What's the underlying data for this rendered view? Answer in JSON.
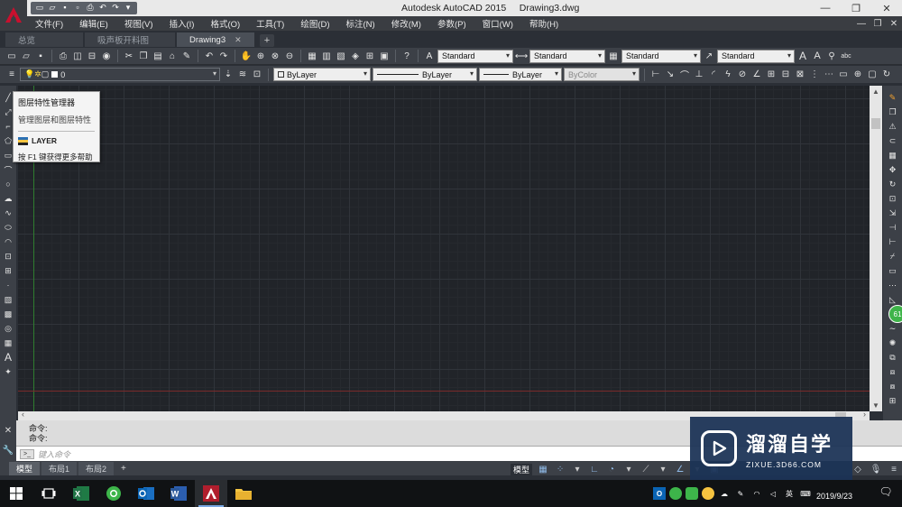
{
  "window": {
    "app_name": "Autodesk AutoCAD 2015",
    "doc_name": "Drawing3.dwg",
    "controls": [
      "—",
      "❐",
      "✕"
    ]
  },
  "menu": {
    "items": [
      "文件(F)",
      "编辑(E)",
      "视图(V)",
      "插入(I)",
      "格式(O)",
      "工具(T)",
      "绘图(D)",
      "标注(N)",
      "修改(M)",
      "参数(P)",
      "窗口(W)",
      "帮助(H)"
    ],
    "right_controls": [
      "—",
      "❐",
      "✕"
    ]
  },
  "file_tabs": [
    {
      "label": "总览"
    },
    {
      "label": "吸声板开料图"
    },
    {
      "label": "Drawing3",
      "close": "✕"
    }
  ],
  "file_tab_add": "+",
  "toolbar1": {
    "text_style": "Standard",
    "dim_style": "Standard",
    "table_style": "Standard",
    "mleader_style": "Standard"
  },
  "toolbar2": {
    "layer": "0",
    "color": "ByLayer",
    "linetype": "ByLayer",
    "lineweight": "ByLayer",
    "plotstyle": "ByColor"
  },
  "tooltip": {
    "title": "图层特性管理器",
    "desc": "管理图层和图层特性",
    "command": "LAYER",
    "help": "按 F1 键获得更多帮助"
  },
  "command": {
    "history": [
      "命令:",
      "命令:"
    ],
    "placeholder": "键入命令"
  },
  "layout_tabs": [
    {
      "label": "模型",
      "active": true
    },
    {
      "label": "布局1",
      "active": false
    },
    {
      "label": "布局2",
      "active": false
    }
  ],
  "layout_tab_add": "+",
  "status": {
    "model": "模型"
  },
  "badge": "61",
  "watermark": {
    "name": "溜溜自学",
    "url": "ZIXUE.3D66.COM"
  },
  "taskbar": {
    "date": "2019/9/23",
    "ime": "英"
  },
  "colors": {
    "canvas_bg": "#212429",
    "ui_dark": "#3c4047",
    "autocad_red": "#c8102e",
    "watermark_bg": "#1c3356"
  }
}
